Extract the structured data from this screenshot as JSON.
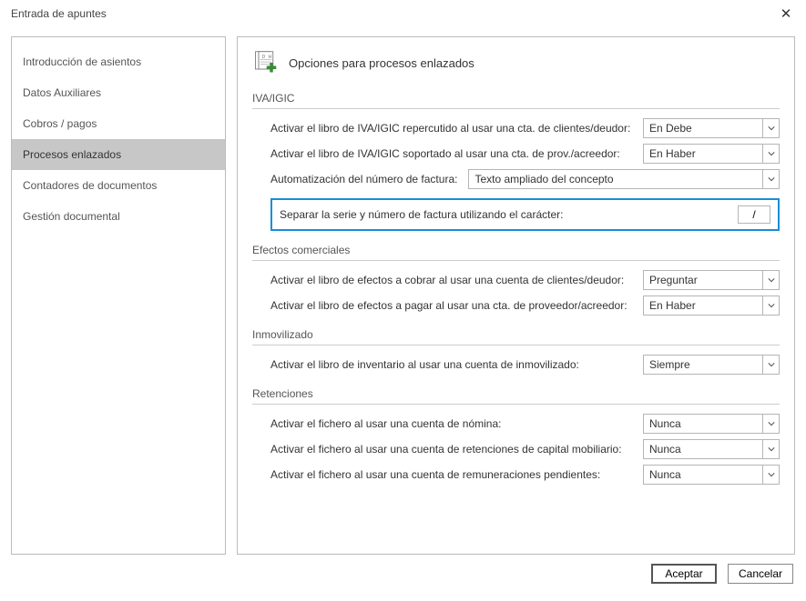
{
  "window": {
    "title": "Entrada de apuntes"
  },
  "sidebar": {
    "items": [
      {
        "label": "Introducción de asientos"
      },
      {
        "label": "Datos Auxiliares"
      },
      {
        "label": "Cobros / pagos"
      },
      {
        "label": "Procesos enlazados"
      },
      {
        "label": "Contadores de documentos"
      },
      {
        "label": "Gestión documental"
      }
    ],
    "active_index": 3
  },
  "main": {
    "header_title": "Opciones para procesos enlazados",
    "sections": {
      "iva": {
        "title": "IVA/IGIC",
        "row1_label": "Activar el libro de IVA/IGIC repercutido al usar una cta. de clientes/deudor:",
        "row1_value": "En Debe",
        "row2_label": "Activar el libro de IVA/IGIC soportado al usar una cta. de prov./acreedor:",
        "row2_value": "En Haber",
        "row3_label": "Automatización del número de factura:",
        "row3_value": "Texto ampliado del concepto",
        "row4_label": "Separar la serie y número de factura utilizando el carácter:",
        "row4_value": "/"
      },
      "efectos": {
        "title": "Efectos comerciales",
        "row1_label": "Activar el libro de efectos a cobrar al usar una cuenta de clientes/deudor:",
        "row1_value": "Preguntar",
        "row2_label": "Activar el libro de efectos a pagar al usar una cta. de proveedor/acreedor:",
        "row2_value": "En Haber"
      },
      "inmov": {
        "title": "Inmovilizado",
        "row1_label": "Activar el libro de inventario al usar una cuenta de inmovilizado:",
        "row1_value": "Siempre"
      },
      "ret": {
        "title": "Retenciones",
        "row1_label": "Activar el fichero al usar una cuenta de nómina:",
        "row1_value": "Nunca",
        "row2_label": "Activar el fichero al usar una cuenta de retenciones de capital mobiliario:",
        "row2_value": "Nunca",
        "row3_label": "Activar el fichero al usar una cuenta de remuneraciones pendientes:",
        "row3_value": "Nunca"
      }
    }
  },
  "footer": {
    "accept": "Aceptar",
    "cancel": "Cancelar"
  }
}
